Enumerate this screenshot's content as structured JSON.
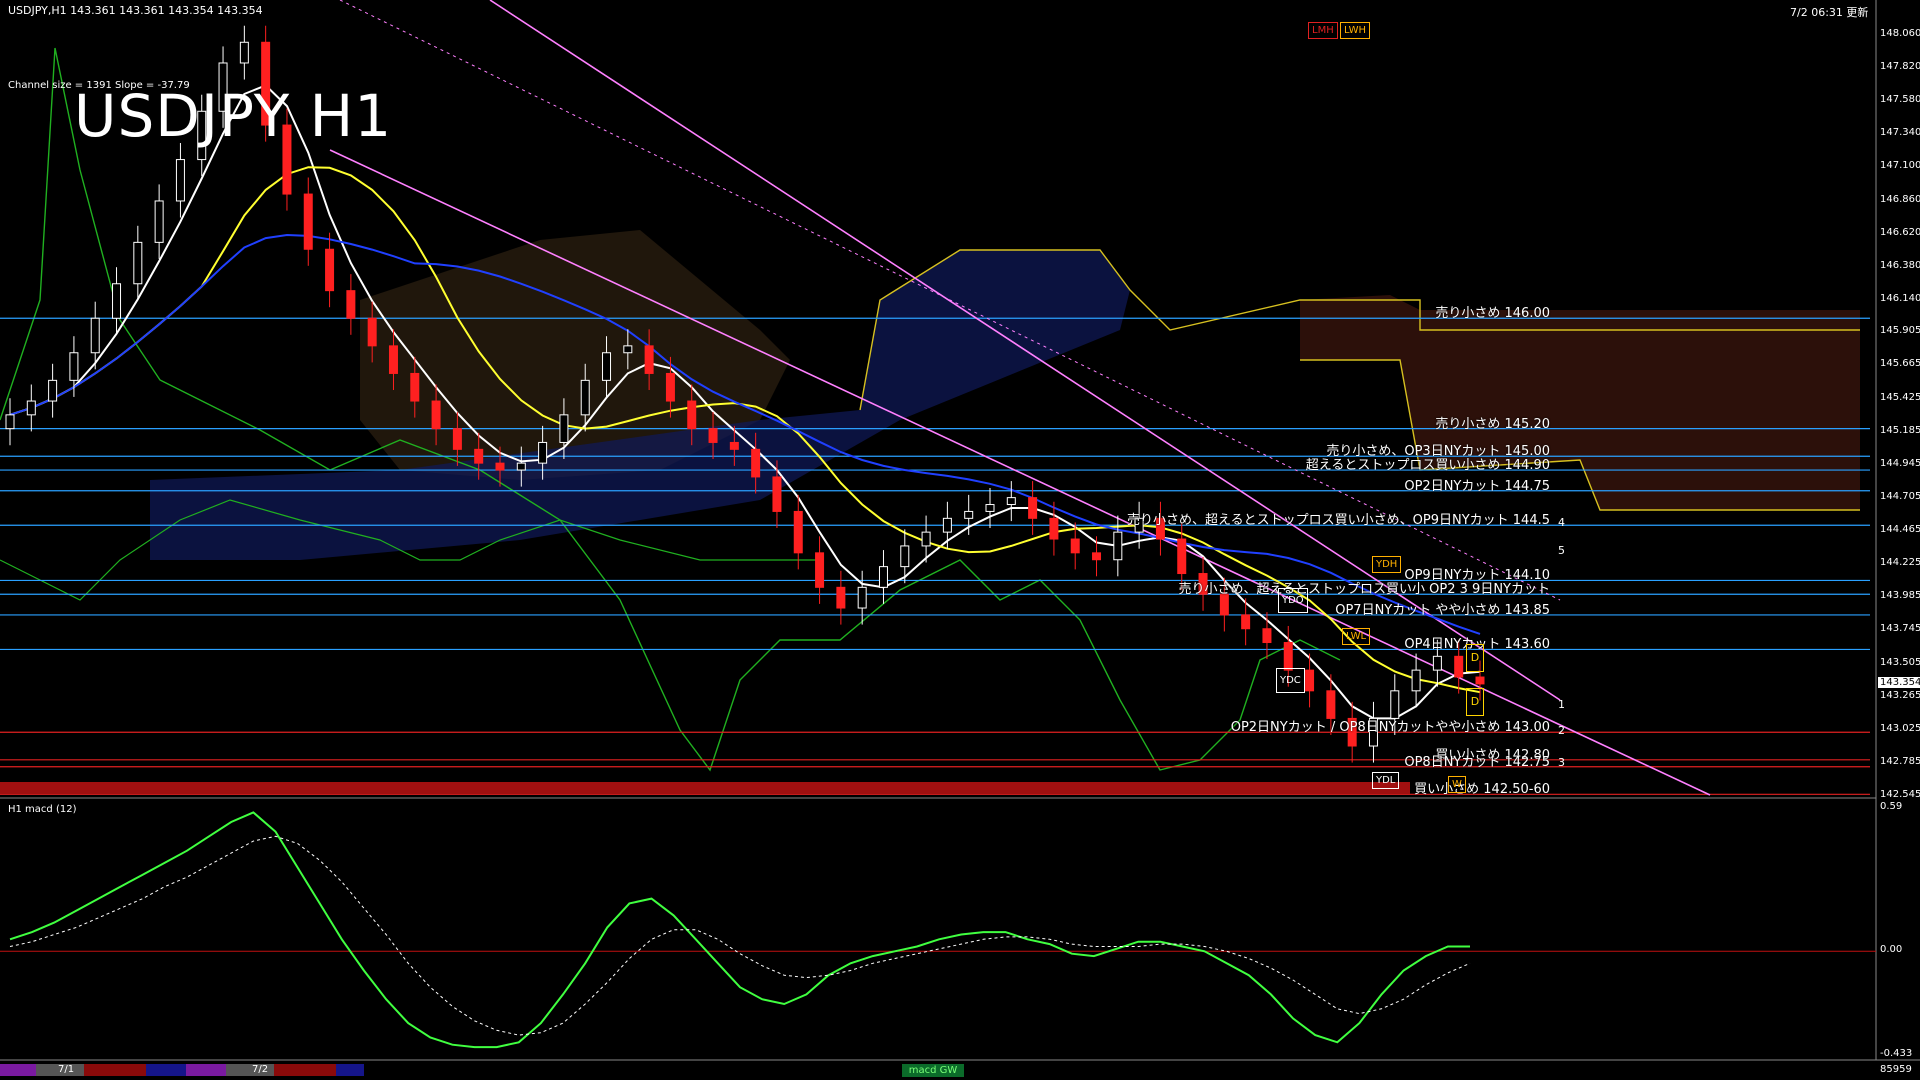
{
  "header": {
    "symbol_info": "USDJPY,H1  143.361 143.361 143.354 143.354",
    "datetime": "7/2 06:31 更新",
    "channel_info": "Channel size = 1391 Slope = -37.79",
    "title": "USDJPY H1",
    "tag_lmh": "LMH",
    "tag_lwh": "LWH"
  },
  "price_axis": {
    "ticks": [
      "148.060",
      "147.820",
      "147.580",
      "147.340",
      "147.100",
      "146.860",
      "146.620",
      "146.380",
      "146.140",
      "145.905",
      "145.665",
      "145.425",
      "145.185",
      "144.945",
      "144.705",
      "144.465",
      "144.225",
      "143.985",
      "143.745",
      "143.505",
      "143.265",
      "143.025",
      "142.785",
      "142.545"
    ],
    "current_price": "143.354"
  },
  "levels": [
    {
      "text": "売り小さめ 146.00",
      "price": 146.0,
      "color": "#2aa0ff"
    },
    {
      "text": "売り小さめ 145.20",
      "price": 145.2,
      "color": "#2aa0ff"
    },
    {
      "text": "売り小さめ、OP3日NYカット 145.00",
      "price": 145.0,
      "color": "#2aa0ff"
    },
    {
      "text": "超えるとストップロス買い小さめ 144.90",
      "price": 144.9,
      "color": "#2aa0ff"
    },
    {
      "text": "OP2日NYカット 144.75",
      "price": 144.75,
      "color": "#2aa0ff"
    },
    {
      "text": "売り小さめ、超えるとストップロス買い小さめ、OP9日NYカット 144.5",
      "price": 144.5,
      "color": "#2aa0ff"
    },
    {
      "text": "OP9日NYカット 144.10",
      "price": 144.1,
      "color": "#2aa0ff"
    },
    {
      "text": "売り小さめ、超えるとストップロス買い小 OP2 3 9日NYカット",
      "price": 144.0,
      "color": "#2aa0ff"
    },
    {
      "text": "OP7日NYカット やや小さめ 143.85",
      "price": 143.85,
      "color": "#2aa0ff"
    },
    {
      "text": "OP4日NYカット 143.60",
      "price": 143.6,
      "color": "#2aa0ff"
    },
    {
      "text": "OP2日NYカット / OP8日NYカットやや小さめ 143.00",
      "price": 143.0,
      "color": "#e02020"
    },
    {
      "text": "買い小さめ 142.80",
      "price": 142.8,
      "color": "#e02020"
    },
    {
      "text": "OP8日NYカット 142.75",
      "price": 142.75,
      "color": "#e02020"
    },
    {
      "text": "買い小さめ 142.50-60",
      "price": 142.55,
      "color": "#e02020"
    }
  ],
  "channel_numbers": [
    "4",
    "5",
    "1",
    "2",
    "3"
  ],
  "boxes": {
    "ydo": "YDO",
    "ydc": "YDC",
    "ydl": "YDL",
    "ydh": "YDH",
    "lwl": "LWL",
    "d1": "D",
    "d2": "D",
    "w": "W"
  },
  "macd": {
    "label": "H1  macd (12)",
    "ticks": [
      "0.59",
      "0.00",
      "-0.433"
    ]
  },
  "footer": {
    "date1": "7/1",
    "date2": "7/2",
    "macd_badge": "macd GW",
    "corner": "85959"
  },
  "colors": {
    "background": "#000000",
    "bull_candle": "#ffffff",
    "bear_candle": "#ff2020",
    "sma_white": "#ffffff",
    "sma_yellow": "#ffff30",
    "sma_blue": "#2040ff",
    "channel": "#ff80ff",
    "macd_line": "#40ff40",
    "macd_signal": "#ffffff"
  },
  "chart_data": [
    {
      "type": "candlestick",
      "title": "USDJPY H1",
      "ylim": [
        142.545,
        148.06
      ],
      "series": [
        {
          "name": "close",
          "values": [
            145.3,
            145.4,
            145.55,
            145.75,
            146.0,
            146.25,
            146.55,
            146.85,
            147.15,
            147.5,
            147.85,
            148.0,
            147.4,
            146.9,
            146.5,
            146.2,
            146.0,
            145.8,
            145.6,
            145.4,
            145.2,
            145.05,
            144.95,
            144.9,
            144.95,
            145.1,
            145.3,
            145.55,
            145.75,
            145.8,
            145.6,
            145.4,
            145.2,
            145.1,
            145.05,
            144.85,
            144.6,
            144.3,
            144.05,
            143.9,
            144.05,
            144.2,
            144.35,
            144.45,
            144.55,
            144.6,
            144.65,
            144.7,
            144.55,
            144.4,
            144.3,
            144.25,
            144.45,
            144.55,
            144.4,
            144.15,
            144.0,
            143.85,
            143.75,
            143.65,
            143.45,
            143.3,
            143.1,
            142.9,
            143.1,
            143.3,
            143.45,
            143.55,
            143.4,
            143.35
          ]
        }
      ]
    },
    {
      "type": "line",
      "title": "macd (12)",
      "ylim": [
        -0.433,
        0.59
      ],
      "series": [
        {
          "name": "macd",
          "values": [
            0.05,
            0.08,
            0.12,
            0.17,
            0.22,
            0.27,
            0.32,
            0.37,
            0.42,
            0.48,
            0.54,
            0.58,
            0.5,
            0.35,
            0.2,
            0.05,
            -0.08,
            -0.2,
            -0.3,
            -0.36,
            -0.39,
            -0.4,
            -0.4,
            -0.38,
            -0.3,
            -0.18,
            -0.05,
            0.1,
            0.2,
            0.22,
            0.15,
            0.05,
            -0.05,
            -0.15,
            -0.2,
            -0.22,
            -0.18,
            -0.1,
            -0.05,
            -0.02,
            0.0,
            0.02,
            0.05,
            0.07,
            0.08,
            0.08,
            0.05,
            0.03,
            -0.01,
            -0.02,
            0.01,
            0.04,
            0.04,
            0.02,
            0.0,
            -0.05,
            -0.1,
            -0.18,
            -0.28,
            -0.35,
            -0.38,
            -0.3,
            -0.18,
            -0.08,
            -0.02,
            0.02,
            0.02
          ]
        },
        {
          "name": "signal",
          "values": [
            0.02,
            0.04,
            0.07,
            0.1,
            0.14,
            0.18,
            0.22,
            0.27,
            0.31,
            0.36,
            0.41,
            0.46,
            0.48,
            0.45,
            0.38,
            0.29,
            0.18,
            0.07,
            -0.05,
            -0.15,
            -0.23,
            -0.29,
            -0.33,
            -0.35,
            -0.34,
            -0.3,
            -0.22,
            -0.13,
            -0.03,
            0.05,
            0.09,
            0.09,
            0.05,
            -0.01,
            -0.06,
            -0.1,
            -0.11,
            -0.1,
            -0.08,
            -0.05,
            -0.03,
            -0.01,
            0.01,
            0.03,
            0.05,
            0.06,
            0.06,
            0.05,
            0.03,
            0.02,
            0.02,
            0.02,
            0.03,
            0.03,
            0.02,
            0.0,
            -0.03,
            -0.07,
            -0.12,
            -0.18,
            -0.24,
            -0.26,
            -0.24,
            -0.2,
            -0.14,
            -0.09,
            -0.05
          ]
        }
      ]
    }
  ]
}
